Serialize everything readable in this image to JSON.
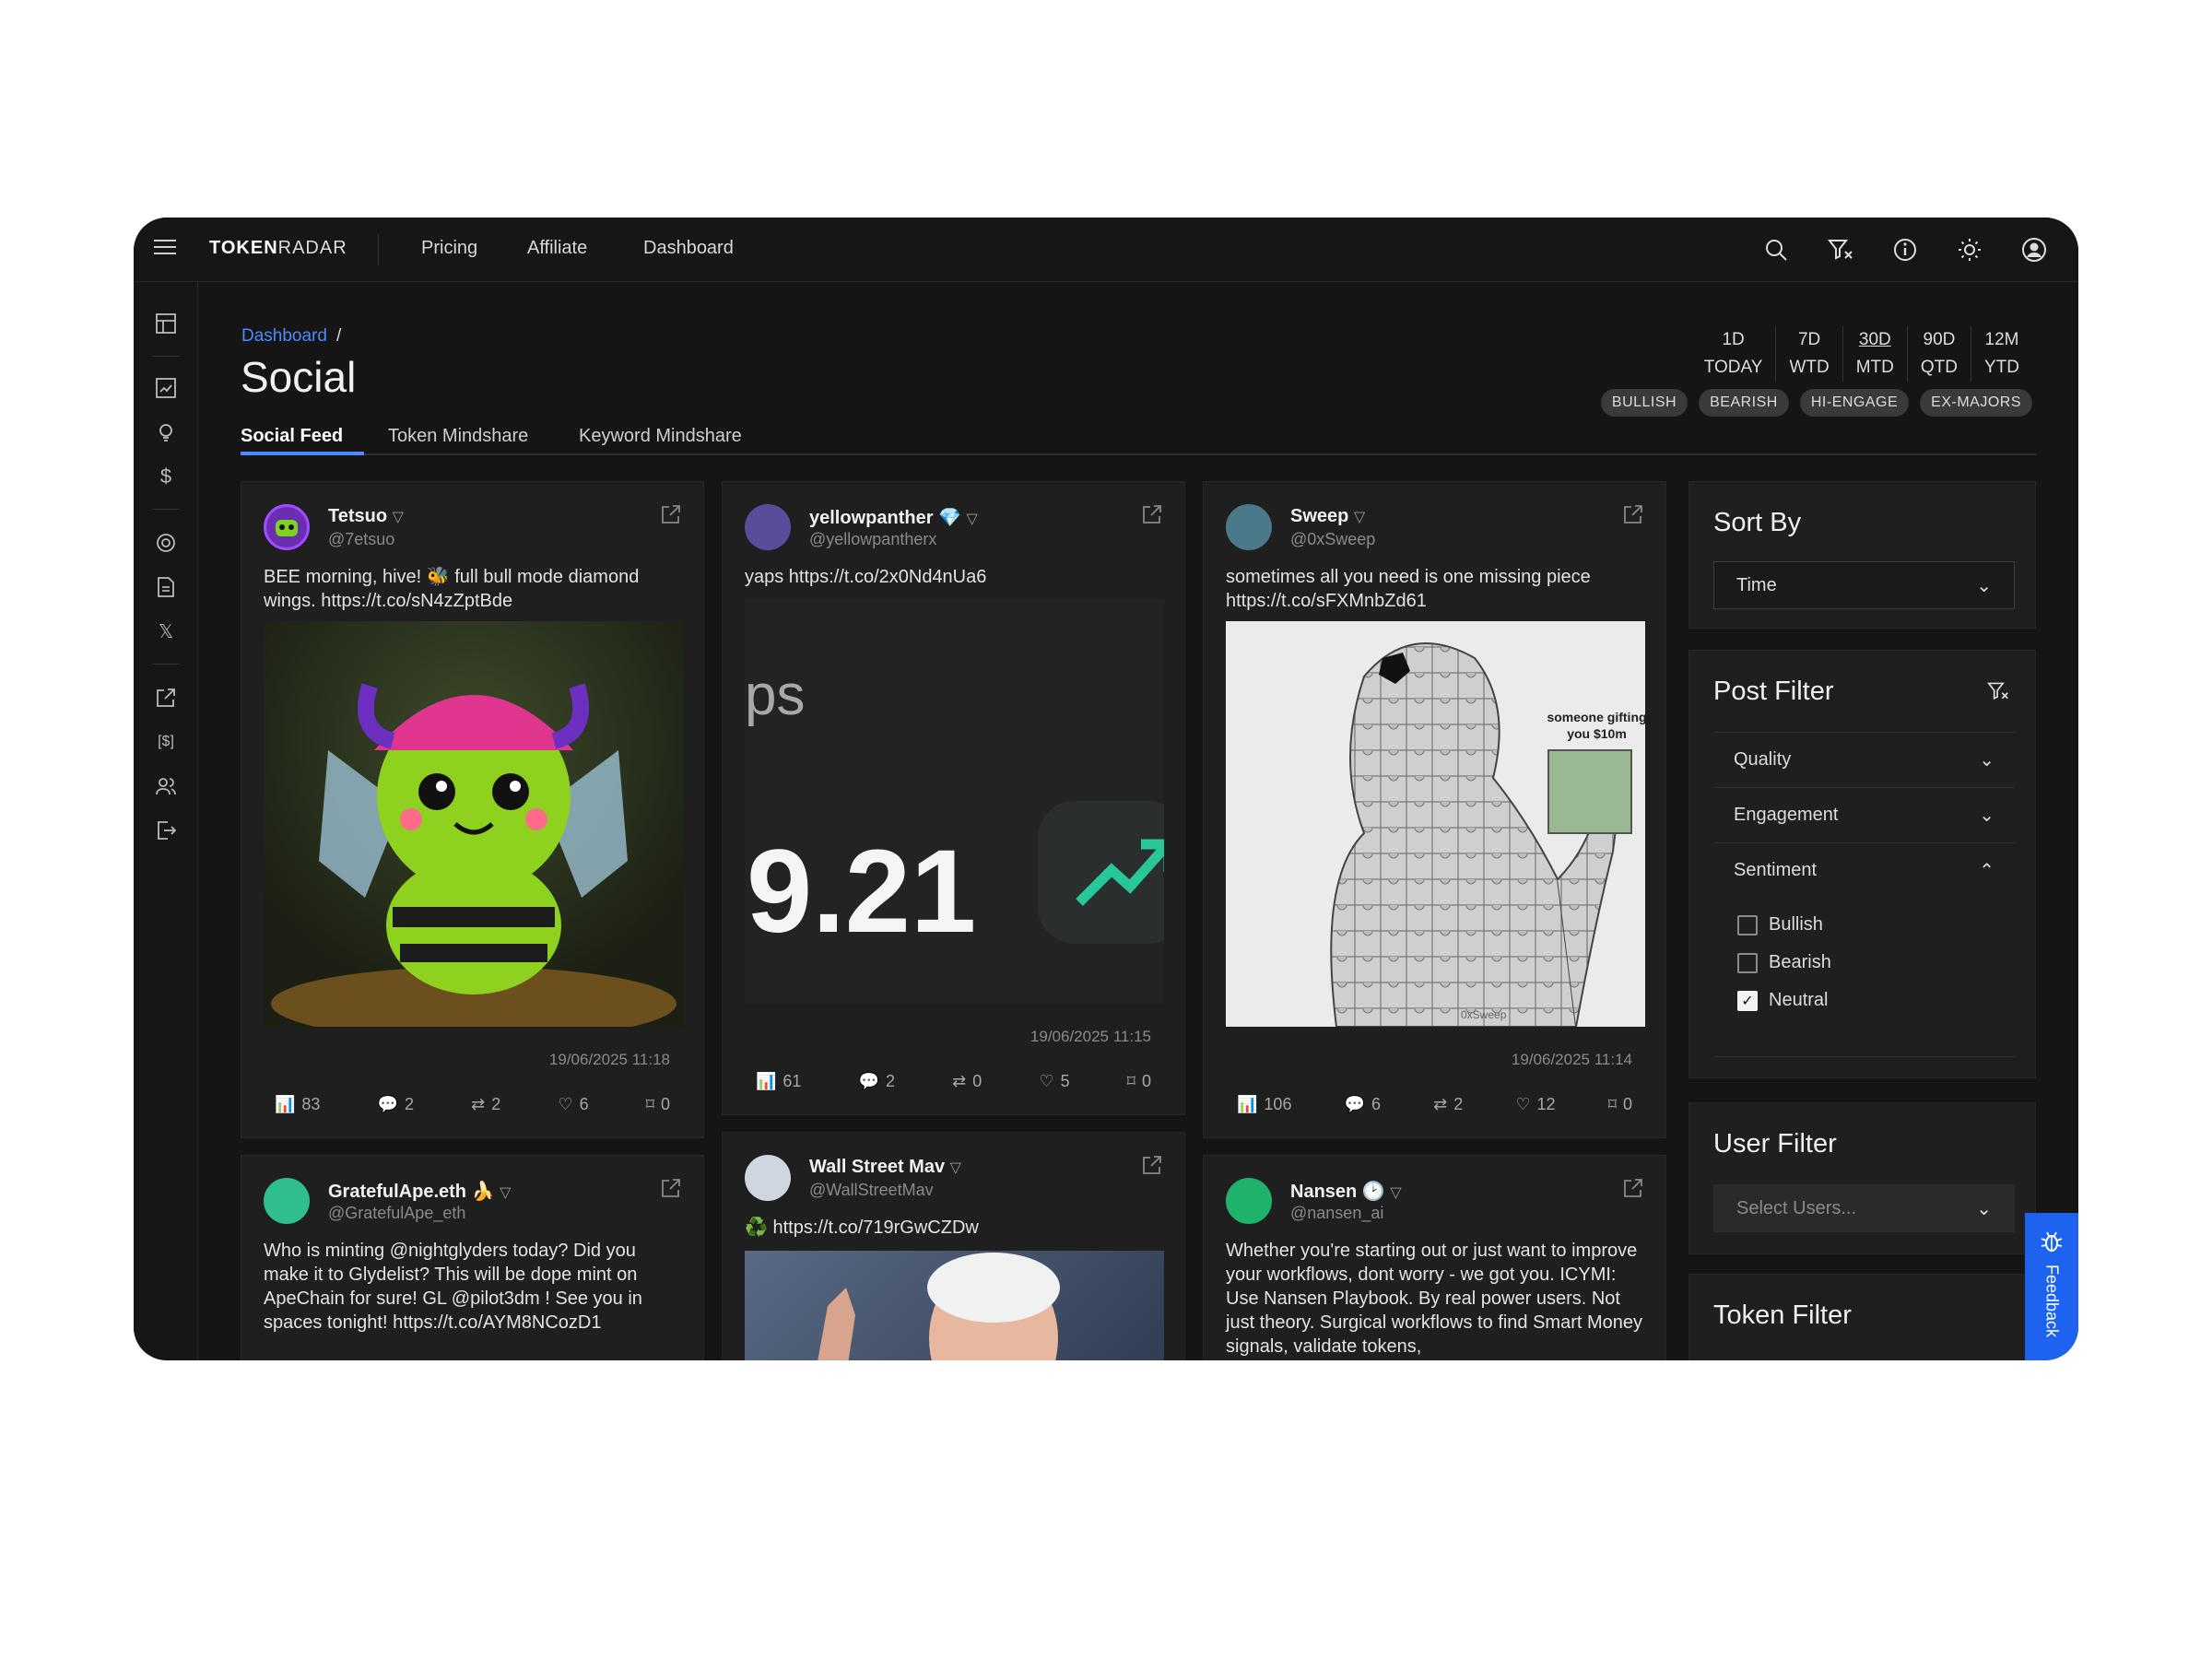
{
  "app": {
    "brand_bold": "TOKEN",
    "brand_rest": "RADAR"
  },
  "nav": {
    "pricing": "Pricing",
    "affiliate": "Affiliate",
    "dashboard": "Dashboard"
  },
  "page": {
    "breadcrumb": "Dashboard",
    "breadcrumb_sep": "/",
    "title": "Social"
  },
  "tabs": [
    "Social Feed",
    "Token Mindshare",
    "Keyword Mindshare"
  ],
  "ranges": [
    {
      "top": "1D",
      "bottom": "TODAY"
    },
    {
      "top": "7D",
      "bottom": "WTD"
    },
    {
      "top": "30D",
      "bottom": "MTD",
      "selected": true
    },
    {
      "top": "90D",
      "bottom": "QTD"
    },
    {
      "top": "12M",
      "bottom": "YTD"
    }
  ],
  "badges": [
    "BULLISH",
    "BEARISH",
    "HI-ENGAGE",
    "EX-MAJORS"
  ],
  "posts": [
    {
      "name": "Tetsuo",
      "handle": "@7etsuo",
      "text": "BEE morning, hive! 🐝 full bull mode diamond wings. https://t.co/sN4zZptBde",
      "timestamp": "19/06/2025 11:18",
      "views": "83",
      "replies": "2",
      "reposts": "2",
      "likes": "6",
      "bookmarks": "0"
    },
    {
      "name": "yellowpanther",
      "badge": "💎",
      "handle": "@yellowpantherx",
      "text": "yaps https://t.co/2x0Nd4nUa6",
      "media_text_a": "ps",
      "media_text_b": "9.21",
      "timestamp": "19/06/2025 11:15",
      "views": "61",
      "replies": "2",
      "reposts": "0",
      "likes": "5",
      "bookmarks": "0"
    },
    {
      "name": "Sweep",
      "handle": "@0xSweep",
      "text": "sometimes all you need is one missing piece https://t.co/sFXMnbZd61",
      "media_caption": "someone gifting you $10m",
      "media_watermark": "0xSweep",
      "timestamp": "19/06/2025 11:14",
      "views": "106",
      "replies": "6",
      "reposts": "2",
      "likes": "12",
      "bookmarks": "0"
    },
    {
      "name": "GratefulApe.eth",
      "badge": "🍌",
      "handle": "@GratefulApe_eth",
      "text": "Who is minting @nightglyders today? Did you make it to Glydelist? This will be dope mint on ApeChain for sure! GL @pilot3dm ! See you in spaces tonight! https://t.co/AYM8NCozD1"
    },
    {
      "name": "Wall Street Mav",
      "handle": "@WallStreetMav",
      "text": "♻️ https://t.co/719rGwCZDw"
    },
    {
      "name": "Nansen",
      "badge": "🕑",
      "handle": "@nansen_ai",
      "text": "Whether you're starting out or just want to improve your workflows, dont worry - we got you. ICYMI: Use Nansen Playbook. By real power users. Not just theory. Surgical workflows to find Smart Money signals, validate tokens,"
    }
  ],
  "sort": {
    "title": "Sort By",
    "value": "Time"
  },
  "post_filter": {
    "title": "Post Filter",
    "sections": [
      "Quality",
      "Engagement",
      "Sentiment"
    ],
    "sentiment": [
      {
        "label": "Bullish",
        "checked": false
      },
      {
        "label": "Bearish",
        "checked": false
      },
      {
        "label": "Neutral",
        "checked": true
      }
    ]
  },
  "user_filter": {
    "title": "User Filter",
    "placeholder": "Select Users..."
  },
  "token_filter": {
    "title": "Token Filter"
  },
  "feedback": "Feedback",
  "colors": {
    "accent": "#4a8cff",
    "feedback_bg": "#1d63f0",
    "bg": "#151515",
    "card": "#1f1f1f"
  }
}
